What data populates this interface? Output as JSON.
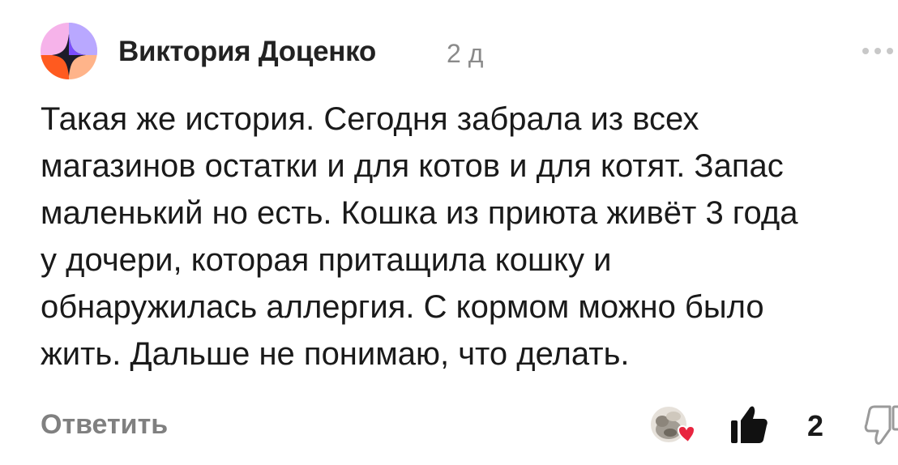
{
  "comment": {
    "author": "Виктория Доценко",
    "timestamp": "2 д",
    "lines": [
      "Такая же история. Сегодня забрала из всех",
      "магазинов остатки и для котов и для котят. Запас",
      "маленький но есть. Кошка из приюта живёт 3 года",
      "у дочери, которая притащила кошку и",
      "обнаружилась аллергия. С кормом можно было",
      "жить. Дальше не понимаю, что делать."
    ],
    "reply_label": "Ответить",
    "like_count": "2"
  },
  "colors": {
    "text": "#1a1a1a",
    "muted": "#808080",
    "avatar_pink": "#f6b3ea",
    "avatar_purple": "#7a4dff",
    "avatar_orange": "#ff5a1f",
    "avatar_peach": "#ffb48a",
    "reaction_heart": "#e8253f"
  },
  "icons": {
    "more": "more-horizontal-icon",
    "like": "thumbs-up-icon",
    "dislike": "thumbs-down-icon",
    "reaction": "heart-reaction-icon"
  }
}
